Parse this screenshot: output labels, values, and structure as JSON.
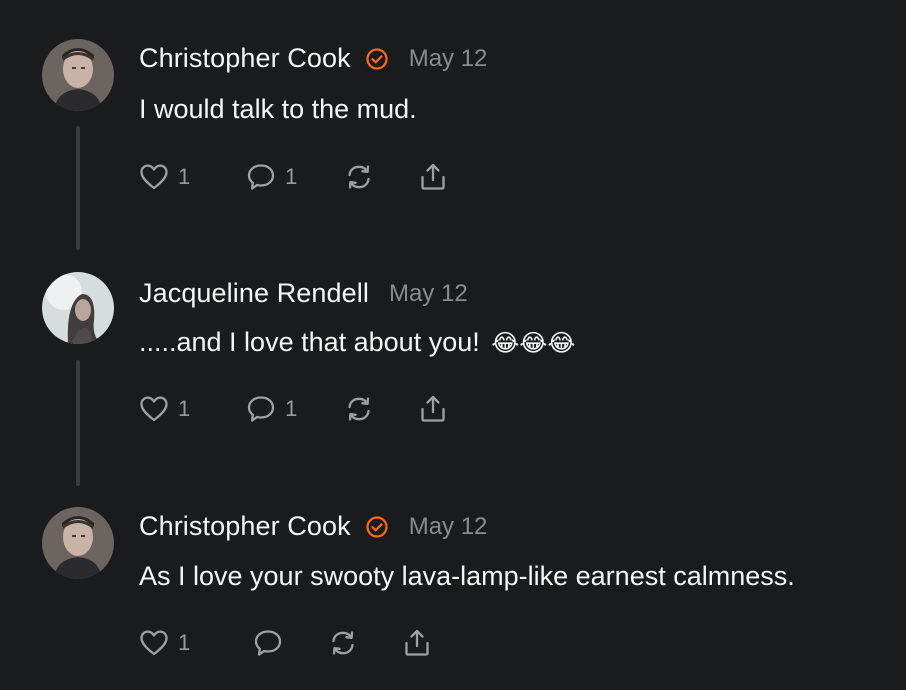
{
  "comments": [
    {
      "author": "Christopher Cook",
      "verified": true,
      "date": "May 12",
      "text": "I would talk to the mud.",
      "emoji": "",
      "likes": "1",
      "replies": "1",
      "avatar_icon": "man-portrait"
    },
    {
      "author": "Jacqueline Rendell",
      "verified": false,
      "date": "May 12",
      "text": ".....and I love that about you!",
      "emoji": "😂😂😂",
      "likes": "1",
      "replies": "1",
      "avatar_icon": "woman-portrait"
    },
    {
      "author": "Christopher Cook",
      "verified": true,
      "date": "May 12",
      "text": "As I love your swooty lava-lamp-like earnest calmness.",
      "emoji": "",
      "likes": "1",
      "replies": "",
      "avatar_icon": "man-portrait"
    }
  ],
  "colors": {
    "background": "#1a1b1d",
    "verified": "#ff6719",
    "muted": "#8b8b8e",
    "icon": "#a0a0a3"
  },
  "icons": {
    "like": "heart-icon",
    "reply": "speech-bubble-icon",
    "restack": "restack-arrows-icon",
    "share": "share-upload-icon",
    "verified": "verified-check-icon"
  }
}
